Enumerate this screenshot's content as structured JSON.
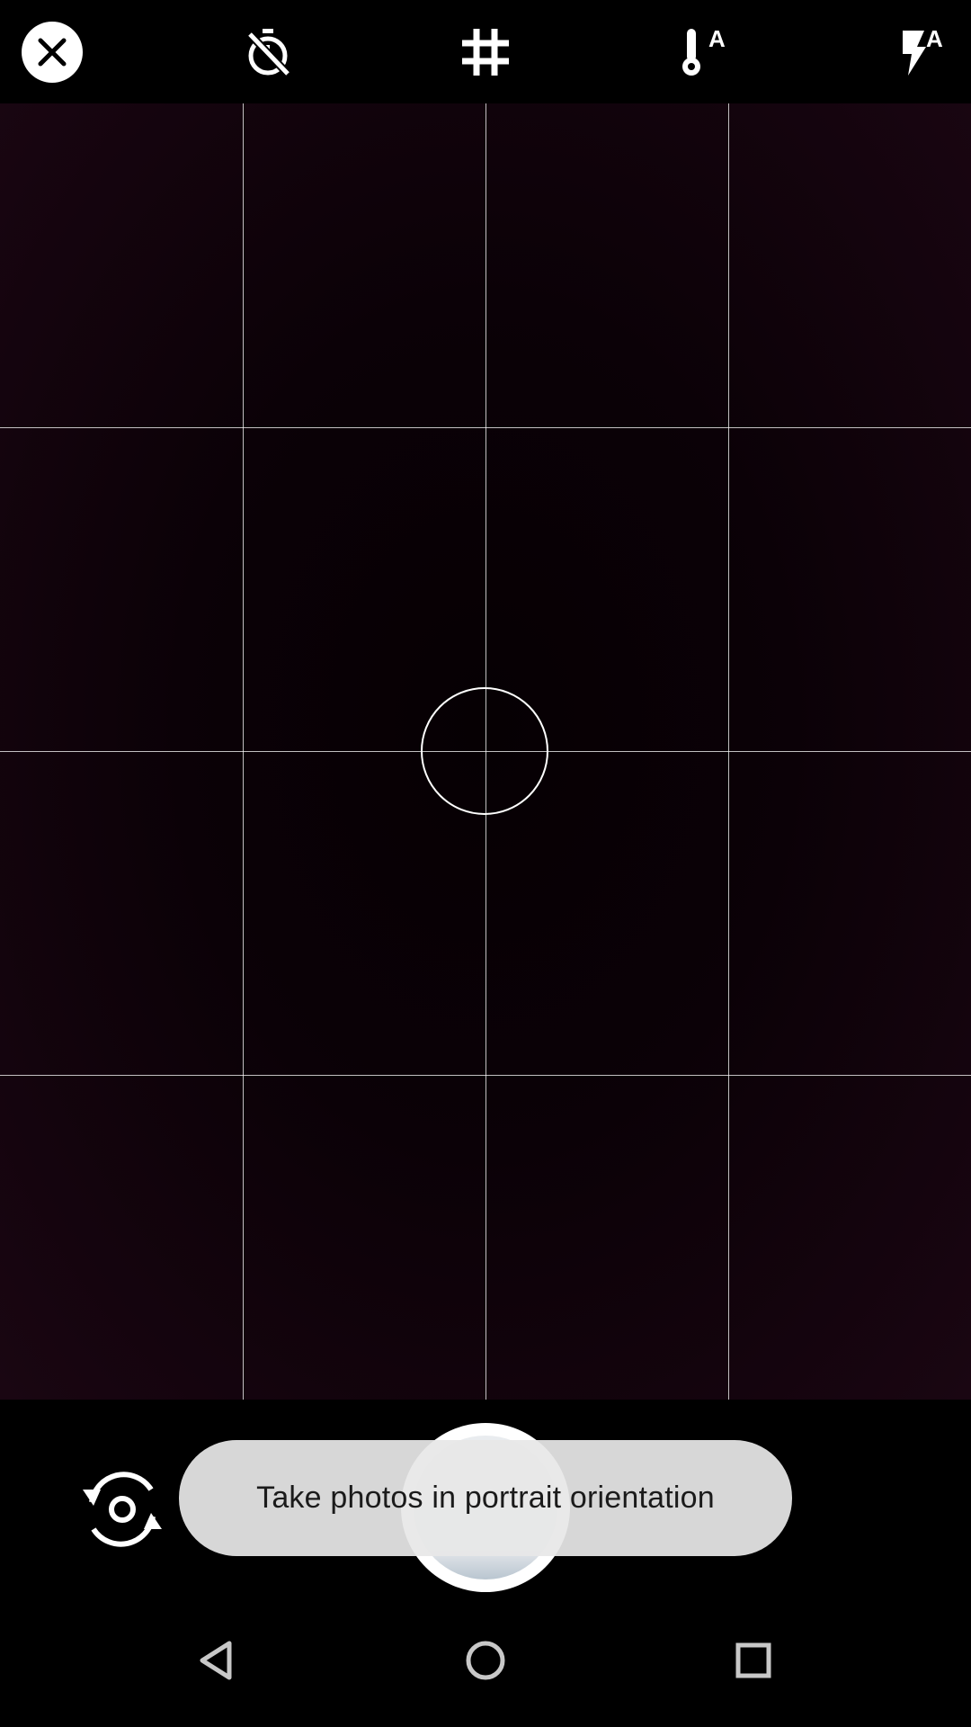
{
  "top_bar": {
    "close_icon": "close-icon",
    "timer_icon": "timer-off-icon",
    "grid_icon": "grid-icon",
    "white_balance_icon": "white-balance-auto-icon",
    "flash_icon": "flash-auto-icon",
    "white_balance_badge": "A",
    "flash_badge": "A"
  },
  "viewfinder": {
    "grid": "4x4",
    "background_color": "#0b0107"
  },
  "controls": {
    "switch_camera_icon": "switch-camera-icon",
    "shutter_icon": "shutter-button"
  },
  "toast": {
    "message": "Take photos in portrait orientation"
  },
  "nav_bar": {
    "back_icon": "back-triangle-icon",
    "home_icon": "home-circle-icon",
    "recents_icon": "recents-square-icon"
  }
}
